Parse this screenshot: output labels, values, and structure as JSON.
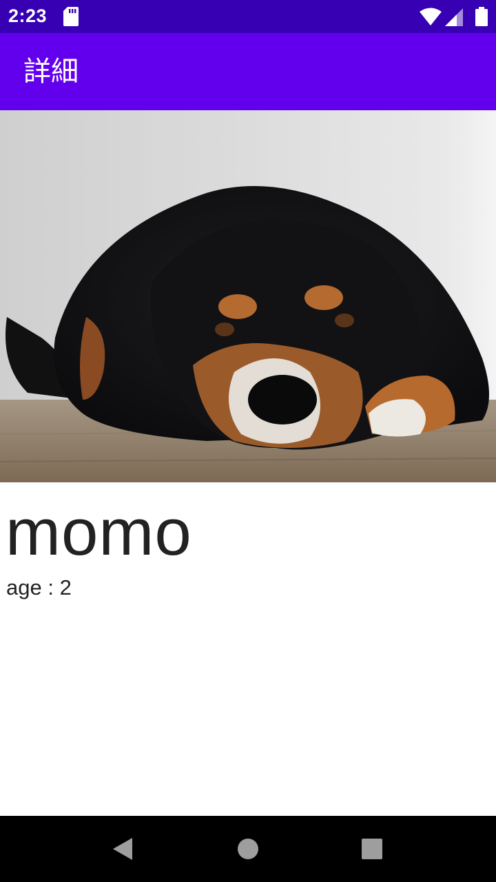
{
  "status_bar": {
    "time": "2:23",
    "icons": [
      "sd-card-icon",
      "wifi-icon",
      "signal-icon",
      "battery-icon"
    ]
  },
  "app_bar": {
    "title": "詳細",
    "color": "#6200ee"
  },
  "pet": {
    "name": "momo",
    "age_label": "age",
    "age_separator": " : ",
    "age_value": "2"
  },
  "nav_bar": {
    "buttons": [
      "back-icon",
      "home-icon",
      "recents-icon"
    ]
  },
  "colors": {
    "status_bar": "#3700b3",
    "app_bar": "#6200ee",
    "text": "#222222",
    "nav_bar": "#000000"
  }
}
